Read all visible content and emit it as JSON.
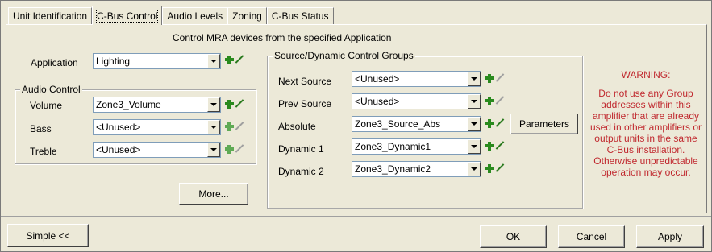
{
  "tabs": [
    {
      "label": "Unit Identification",
      "active": false
    },
    {
      "label": "C-Bus Control",
      "active": true
    },
    {
      "label": "Audio Levels",
      "active": false
    },
    {
      "label": "Zoning",
      "active": false
    },
    {
      "label": "C-Bus Status",
      "active": false
    }
  ],
  "caption": "Control MRA devices from the specified Application",
  "application": {
    "label": "Application",
    "value": "Lighting"
  },
  "audio_control": {
    "title": "Audio Control",
    "rows": [
      {
        "label": "Volume",
        "value": "Zone3_Volume"
      },
      {
        "label": "Bass",
        "value": "<Unused>"
      },
      {
        "label": "Treble",
        "value": "<Unused>"
      }
    ]
  },
  "more_button": "More...",
  "source_groups": {
    "title": "Source/Dynamic Control Groups",
    "rows": [
      {
        "label": "Next Source",
        "value": "<Unused>"
      },
      {
        "label": "Prev Source",
        "value": "<Unused>"
      },
      {
        "label": "Absolute",
        "value": "Zone3_Source_Abs"
      },
      {
        "label": "Dynamic 1",
        "value": "Zone3_Dynamic1"
      },
      {
        "label": "Dynamic 2",
        "value": "Zone3_Dynamic2"
      }
    ]
  },
  "parameters_button": "Parameters",
  "warning": {
    "title": "WARNING:",
    "body": "Do not use any Group addresses within this amplifier that are already used in other amplifiers or output units in the same C-Bus installation. Otherwise unpredictable operation may occur.",
    "color": "#c0282e"
  },
  "footer": {
    "simple": "Simple <<",
    "ok": "OK",
    "cancel": "Cancel",
    "apply": "Apply"
  },
  "colors": {
    "background": "#ece9d8",
    "add_icon": "#2a8a1e"
  }
}
